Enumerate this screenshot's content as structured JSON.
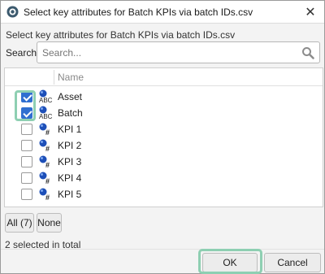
{
  "window": {
    "title": "Select key attributes for Batch KPIs via batch IDs.csv",
    "close_glyph": "✕",
    "app_icon": "dialog-app-icon"
  },
  "subtitle": "Select key attributes for Batch KPIs via batch IDs.csv",
  "search": {
    "label": "Search:",
    "placeholder": "Search...",
    "icon": "search-icon"
  },
  "list": {
    "column_header": "Name",
    "items": [
      {
        "label": "Asset",
        "checked": true,
        "type_icon": "text-abc-icon"
      },
      {
        "label": "Batch",
        "checked": true,
        "type_icon": "text-abc-icon"
      },
      {
        "label": "KPI 1",
        "checked": false,
        "type_icon": "number-hash-icon"
      },
      {
        "label": "KPI 2",
        "checked": false,
        "type_icon": "number-hash-icon"
      },
      {
        "label": "KPI 3",
        "checked": false,
        "type_icon": "number-hash-icon"
      },
      {
        "label": "KPI 4",
        "checked": false,
        "type_icon": "number-hash-icon"
      },
      {
        "label": "KPI 5",
        "checked": false,
        "type_icon": "number-hash-icon"
      }
    ]
  },
  "buttons": {
    "all_label": "All (7)",
    "none_label": "None",
    "ok_label": "OK",
    "cancel_label": "Cancel"
  },
  "status": "2 selected in total",
  "colors": {
    "accent": "#2f6fd0",
    "highlight": "#8ecfb2"
  }
}
